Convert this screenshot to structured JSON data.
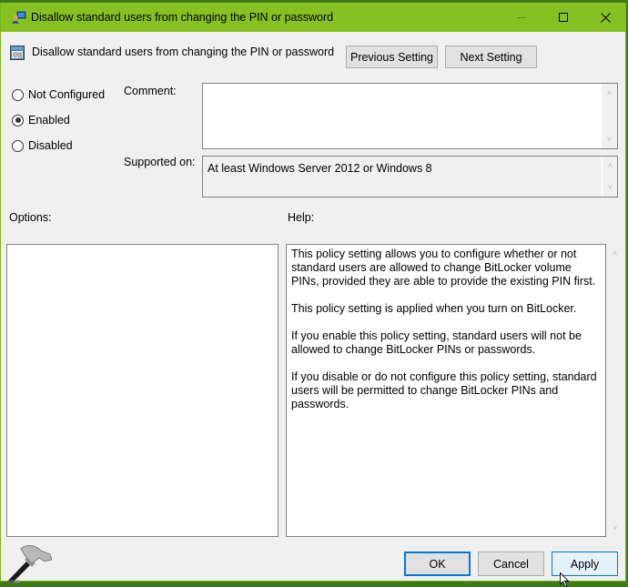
{
  "window": {
    "title": "Disallow standard users from changing the PIN or password",
    "controls": {
      "minimize": "minimize",
      "maximize": "maximize",
      "close": "close"
    }
  },
  "header": {
    "policy_name": "Disallow standard users from changing the PIN or password",
    "previous_label": "Previous Setting",
    "next_label": "Next Setting"
  },
  "state": {
    "options": [
      {
        "label": "Not Configured",
        "checked": false
      },
      {
        "label": "Enabled",
        "checked": true
      },
      {
        "label": "Disabled",
        "checked": false
      }
    ],
    "selected": "Enabled"
  },
  "comment": {
    "label": "Comment:",
    "value": ""
  },
  "supported": {
    "label": "Supported on:",
    "value": "At least Windows Server 2012 or Windows 8"
  },
  "options_panel": {
    "label": "Options:"
  },
  "help_panel": {
    "label": "Help:",
    "paragraphs": [
      "This policy setting allows you to configure whether or not standard users are allowed to change BitLocker volume PINs, provided they are able to provide the existing PIN first.",
      "This policy setting is applied when you turn on BitLocker.",
      "If you enable this policy setting, standard users will not be allowed to change BitLocker PINs or passwords.",
      "If you disable or do not configure this policy setting, standard users will be permitted to change BitLocker PINs and passwords."
    ]
  },
  "footer": {
    "ok_label": "OK",
    "cancel_label": "Cancel",
    "apply_label": "Apply"
  },
  "icons": {
    "scroll_up": "˄",
    "scroll_down": "˅",
    "close_glyph": "✕"
  },
  "colors": {
    "titlebar": "#86c121",
    "accent": "#0078d7"
  }
}
